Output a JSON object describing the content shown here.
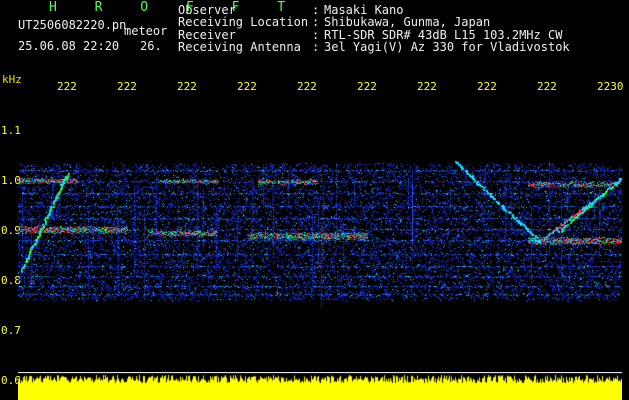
{
  "header": {
    "title": "H R O F F T",
    "file_name": "UT2506082220.pn",
    "meteor_label": "meteor",
    "datetime": "25.06.08 22:20",
    "count": "26."
  },
  "info": [
    {
      "key": "Observer",
      "value": "Masaki Kano"
    },
    {
      "key": "Receiving Location",
      "value": "Shibukawa, Gunma, Japan"
    },
    {
      "key": "Receiver",
      "value": "RTL-SDR SDR# 43dB L15 103.2MHz CW"
    },
    {
      "key": "Receiving Antenna",
      "value": "3el Yagi(V) Az 330 for Vladivostok"
    }
  ],
  "axes": {
    "unit": "kHz",
    "time_labels": [
      "222",
      "222",
      "222",
      "222",
      "222",
      "222",
      "222",
      "222",
      "222",
      "2230"
    ],
    "freq_labels": [
      "1.1",
      "1.0",
      "0.9",
      "0.8",
      "0.7",
      "0.6"
    ]
  },
  "colors": {
    "background": "#000000",
    "title_green": "#4bff5a",
    "axis_yellow": "#ffff30",
    "power_yellow": "#ffff00",
    "noise_dark_blue": "#0a1a8c",
    "signal_blue": "#2a48ff",
    "signal_cyan": "#19e0ff",
    "signal_green": "#20ff40",
    "signal_red": "#ff2020"
  }
}
